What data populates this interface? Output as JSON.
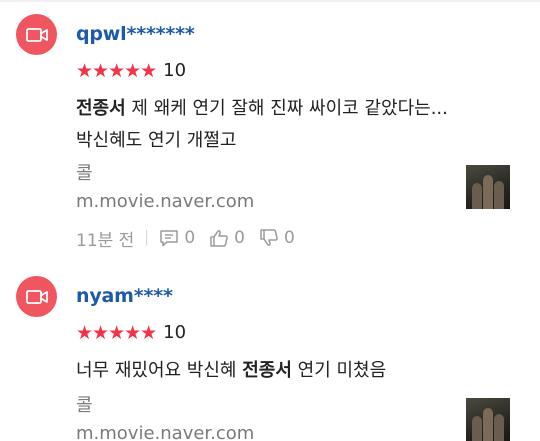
{
  "reviews": [
    {
      "username": "qpwl*******",
      "stars": "★★★★★",
      "score": "10",
      "text_lines": [
        {
          "bold": "전종서",
          "rest": " 제 왜케 연기 잘해 진짜 싸이코 같았다는..."
        },
        {
          "bold": "",
          "rest": "박신혜도 연기 개쩔고"
        }
      ],
      "source_name": "콜",
      "source_url": "m.movie.naver.com",
      "time": "11분 전",
      "comments": "0",
      "likes": "0",
      "dislikes": "0"
    },
    {
      "username": "nyam****",
      "stars": "★★★★★",
      "score": "10",
      "text_lines": [
        {
          "pre": "너무 재밌어요 박신혜 ",
          "bold": "전종서",
          "rest": " 연기 미쳤음"
        }
      ],
      "source_name": "콜",
      "source_url": "m.movie.naver.com"
    }
  ],
  "icons": {
    "avatar": "video-camera-icon",
    "comment": "comment-icon",
    "like": "thumbs-up-icon",
    "dislike": "thumbs-down-icon"
  },
  "colors": {
    "avatar_bg": "#f0565f",
    "username": "#1d5aa8",
    "stars": "#f0344a",
    "muted": "#9b9b9b"
  }
}
